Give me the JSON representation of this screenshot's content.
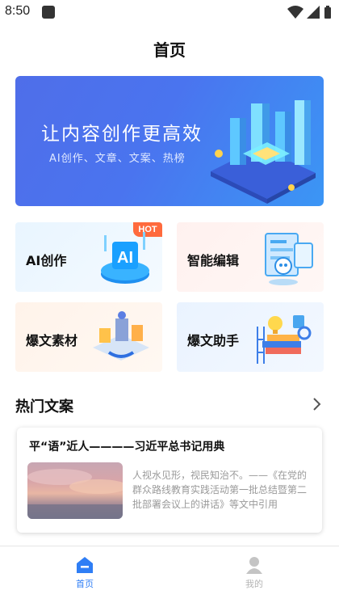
{
  "status_bar": {
    "time": "8:50"
  },
  "header": {
    "title": "首页"
  },
  "banner": {
    "headline": "让内容创作更高效",
    "subtitle": "AI创作、文章、文案、热榜"
  },
  "features": [
    {
      "label": "AI创作",
      "badge": "HOT"
    },
    {
      "label": "智能编辑"
    },
    {
      "label": "爆文素材"
    },
    {
      "label": "爆文助手"
    }
  ],
  "section": {
    "title": "热门文案"
  },
  "article": {
    "title": "平“语”近人————习近平总书记用典",
    "excerpt": "人视水见形，视民知治不。——《在党的群众路线教育实践活动第一批总结暨第二批部署会议上的讲话》等文中引用"
  },
  "tabbar": {
    "items": [
      {
        "label": "首页",
        "active": true
      },
      {
        "label": "我的",
        "active": false
      }
    ]
  },
  "colors": {
    "accent": "#2f7ef5",
    "hot_badge": "#ff6a3d",
    "banner_start": "#4f6ee9",
    "banner_end": "#3b96f5"
  }
}
